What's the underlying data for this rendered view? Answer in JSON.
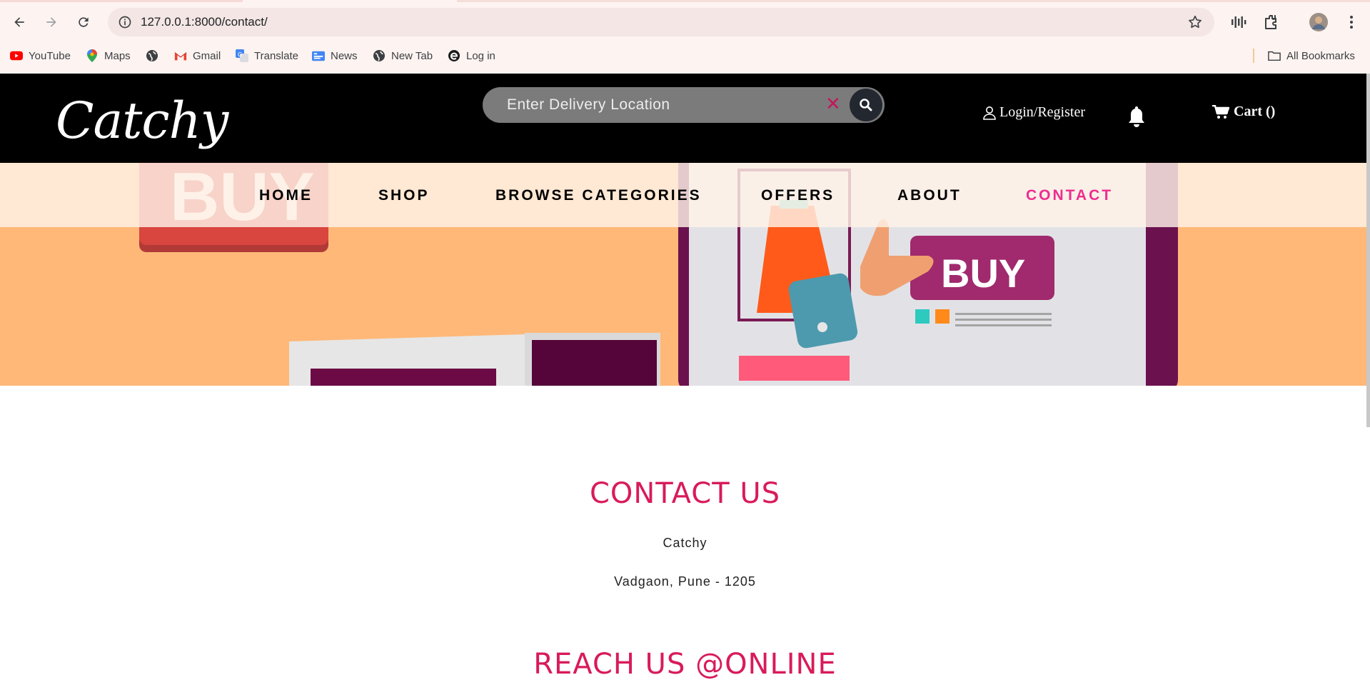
{
  "browser": {
    "url": "127.0.0.1:8000/contact/",
    "bookmarks": [
      "YouTube",
      "Maps",
      "Gmail",
      "Translate",
      "News",
      "New Tab",
      "Log in"
    ],
    "all_bookmarks": "All Bookmarks"
  },
  "site": {
    "logo": "Catchy",
    "search_placeholder": "Enter Delivery Location",
    "login_label": "Login/Register",
    "cart_label": "Cart ()",
    "nav": [
      "HOME",
      "SHOP",
      "BROWSE CATEGORIES",
      "OFFERS",
      "ABOUT",
      "CONTACT"
    ],
    "active_nav": "CONTACT",
    "hero_buy_text": "BUY"
  },
  "content": {
    "contact_title": "CONTACT US",
    "company": "Catchy",
    "address": "Vadgaon, Pune - 1205",
    "online_title": "REACH US @ONLINE"
  },
  "colors": {
    "accent": "#d81b5a",
    "active_nav": "#ee2d8f",
    "hero_bg": "#ffb878",
    "header_bg": "#000000"
  }
}
